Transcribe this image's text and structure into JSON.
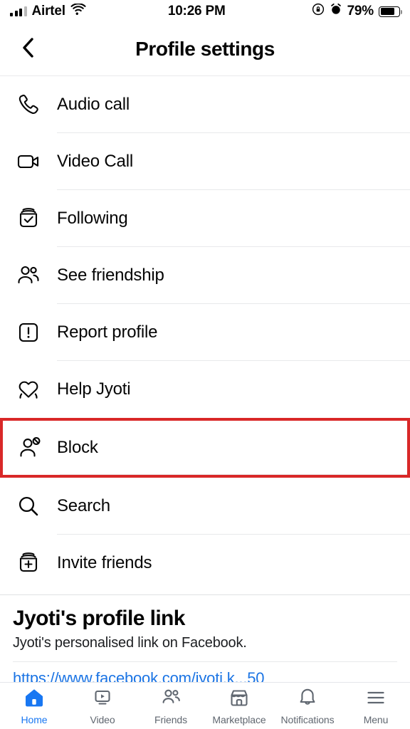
{
  "status_bar": {
    "carrier": "Airtel",
    "signal_icon": "signal-bars-icon",
    "wifi_icon": "wifi-icon",
    "time": "10:26 PM",
    "rotation_lock_icon": "rotation-lock-icon",
    "alarm_icon": "alarm-clock-icon",
    "battery_percent": "79%",
    "battery_icon": "battery-icon"
  },
  "header": {
    "back_icon": "back-chevron-icon",
    "title": "Profile settings"
  },
  "menu": {
    "items": [
      {
        "label": "Audio call",
        "icon": "phone-icon"
      },
      {
        "label": "Video Call",
        "icon": "video-camera-icon"
      },
      {
        "label": "Following",
        "icon": "following-check-icon"
      },
      {
        "label": "See friendship",
        "icon": "two-people-icon"
      },
      {
        "label": "Report profile",
        "icon": "exclamation-square-icon"
      },
      {
        "label": "Help Jyoti",
        "icon": "heart-hands-icon"
      },
      {
        "label": "Block",
        "icon": "block-person-icon",
        "highlighted": true
      },
      {
        "label": "Search",
        "icon": "magnifier-icon"
      },
      {
        "label": "Invite friends",
        "icon": "add-card-icon"
      }
    ],
    "highlight_color": "#d92828"
  },
  "profile_link": {
    "title": "Jyoti's profile link",
    "subtitle": "Jyoti's personalised link on Facebook.",
    "url": "https://www.facebook.com/jyoti.k...50",
    "link_color": "#1b74e4"
  },
  "bottom_nav": {
    "active_color": "#1877f2",
    "items": [
      {
        "label": "Home",
        "icon": "home-icon",
        "active": true
      },
      {
        "label": "Video",
        "icon": "video-play-icon",
        "active": false
      },
      {
        "label": "Friends",
        "icon": "friends-icon",
        "active": false
      },
      {
        "label": "Marketplace",
        "icon": "marketplace-icon",
        "active": false
      },
      {
        "label": "Notifications",
        "icon": "bell-icon",
        "active": false
      },
      {
        "label": "Menu",
        "icon": "hamburger-icon",
        "active": false
      }
    ]
  }
}
